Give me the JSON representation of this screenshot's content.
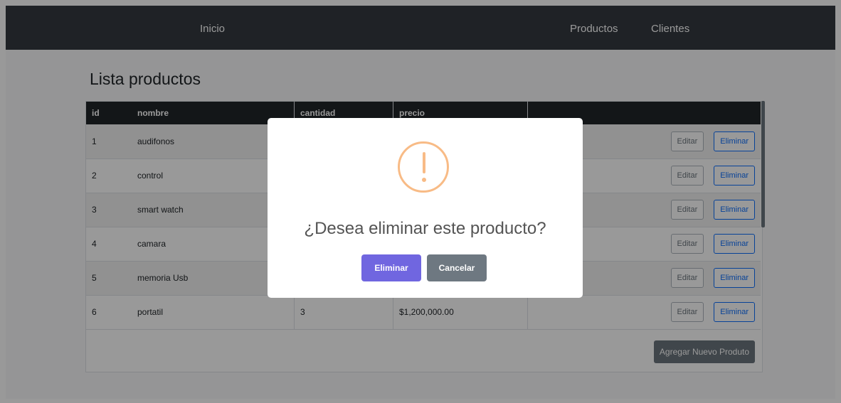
{
  "navbar": {
    "brand": "Inicio",
    "links": [
      "Productos",
      "Clientes"
    ]
  },
  "page_title": "Lista productos",
  "table": {
    "headers": [
      "id",
      "nombre",
      "cantidad",
      "precio"
    ],
    "rows": [
      {
        "id": "1",
        "nombre": "audifonos",
        "cantidad": "",
        "precio": ""
      },
      {
        "id": "2",
        "nombre": "control",
        "cantidad": "",
        "precio": ""
      },
      {
        "id": "3",
        "nombre": "smart watch",
        "cantidad": "",
        "precio": ""
      },
      {
        "id": "4",
        "nombre": "camara",
        "cantidad": "",
        "precio": ""
      },
      {
        "id": "5",
        "nombre": "memoria Usb",
        "cantidad": "",
        "precio": ""
      },
      {
        "id": "6",
        "nombre": "portatil",
        "cantidad": "3",
        "precio": "$1,200,000.00"
      }
    ],
    "edit_label": "Editar",
    "delete_label": "Eliminar"
  },
  "add_button": "Agregar Nuevo Produto",
  "modal": {
    "message": "¿Desea eliminar este producto?",
    "confirm_label": "Eliminar",
    "cancel_label": "Cancelar",
    "icon": "warning-icon",
    "icon_color": "#f8bb86"
  },
  "colors": {
    "navbar": "#343a40",
    "table_header": "#212529",
    "confirm": "#7066e0",
    "cancel": "#6e7881"
  }
}
